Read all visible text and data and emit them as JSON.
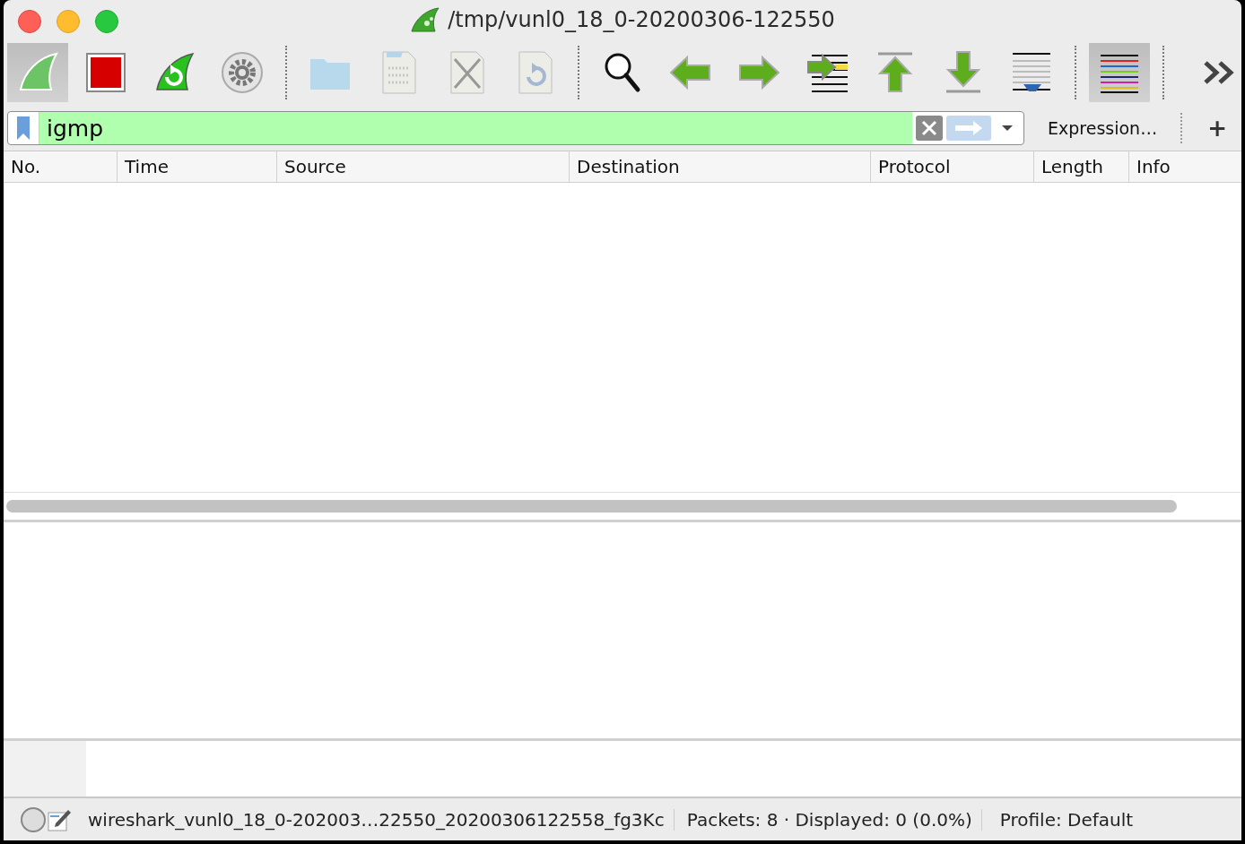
{
  "window": {
    "title": "/tmp/vunl0_18_0-20200306-122550"
  },
  "toolbar": [
    {
      "kind": "start",
      "selected": true,
      "disabled": false
    },
    {
      "kind": "stop",
      "selected": false,
      "disabled": false
    },
    {
      "kind": "restart",
      "selected": false,
      "disabled": false
    },
    {
      "kind": "options",
      "selected": false,
      "disabled": false
    },
    {
      "kind": "sep"
    },
    {
      "kind": "open",
      "selected": false,
      "disabled": true
    },
    {
      "kind": "save",
      "selected": false,
      "disabled": true
    },
    {
      "kind": "close",
      "selected": false,
      "disabled": true
    },
    {
      "kind": "reload",
      "selected": false,
      "disabled": true
    },
    {
      "kind": "sep"
    },
    {
      "kind": "find",
      "selected": false,
      "disabled": false
    },
    {
      "kind": "back",
      "selected": false,
      "disabled": false
    },
    {
      "kind": "forward",
      "selected": false,
      "disabled": false
    },
    {
      "kind": "goto",
      "selected": false,
      "disabled": false
    },
    {
      "kind": "first",
      "selected": false,
      "disabled": false
    },
    {
      "kind": "last",
      "selected": false,
      "disabled": false
    },
    {
      "kind": "autoscroll",
      "selected": false,
      "disabled": false
    },
    {
      "kind": "sep"
    },
    {
      "kind": "colorize",
      "selected": true,
      "disabled": false
    },
    {
      "kind": "sep"
    },
    {
      "kind": "more",
      "selected": false,
      "disabled": false
    }
  ],
  "filter": {
    "value": "igmp",
    "valid": true,
    "expression_button": "Expression…",
    "add_button": "+"
  },
  "packet_list": {
    "columns": [
      "No.",
      "Time",
      "Source",
      "Destination",
      "Protocol",
      "Length",
      "Info"
    ]
  },
  "status_bar": {
    "file": "wireshark_vunl0_18_0-202003…22550_20200306122558_fg3Kc",
    "packets": "Packets: 8 · Displayed: 0 (0.0%)",
    "profile": "Profile: Default"
  }
}
